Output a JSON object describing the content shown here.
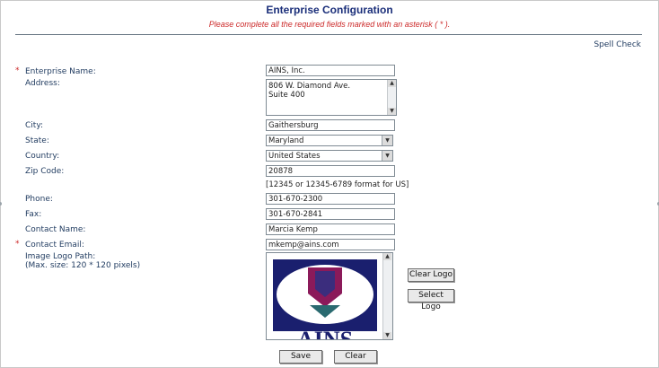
{
  "header": {
    "title": "Enterprise Configuration",
    "instruction": "Please complete all the required fields marked with an asterisk ( * ).",
    "spell_check": "Spell Check"
  },
  "form": {
    "required_marker": "*",
    "enterprise_name": {
      "label": "Enterprise Name:",
      "value": "AINS, Inc."
    },
    "address": {
      "label": "Address:",
      "line1": "806 W. Diamond Ave.",
      "line2": "Suite 400"
    },
    "city": {
      "label": "City:",
      "value": "Gaithersburg"
    },
    "state": {
      "label": "State:",
      "value": "Maryland"
    },
    "country": {
      "label": "Country:",
      "value": "United States"
    },
    "zip": {
      "label": "Zip Code:",
      "value": "20878",
      "hint": "[12345 or 12345-6789 format for US]"
    },
    "phone": {
      "label": "Phone:",
      "value": "301-670-2300"
    },
    "fax": {
      "label": "Fax:",
      "value": "301-670-2841"
    },
    "contact_name": {
      "label": "Contact Name:",
      "value": "Marcia Kemp"
    },
    "contact_email": {
      "label": "Contact Email:",
      "value": "mkemp@ains.com"
    },
    "image_logo": {
      "label": "Image Logo Path:\n(Max. size: 120 * 120 pixels)",
      "logo_text": "AINS"
    }
  },
  "buttons": {
    "clear_logo": "Clear Logo",
    "select_logo": "Select Logo",
    "save": "Save",
    "clear": "Clear"
  },
  "icons": {
    "dropdown": "chevron-down-icon",
    "scroll_up": "scroll-up-arrow-icon",
    "scroll_down": "scroll-down-arrow-icon"
  },
  "colors": {
    "title": "#1b2f7a",
    "instruction": "#cc2a2a",
    "label": "#1f3a5f",
    "logo_navy": "#1a1f6e",
    "logo_teal": "#2a6a70",
    "logo_magenta": "#8b1a5a"
  }
}
